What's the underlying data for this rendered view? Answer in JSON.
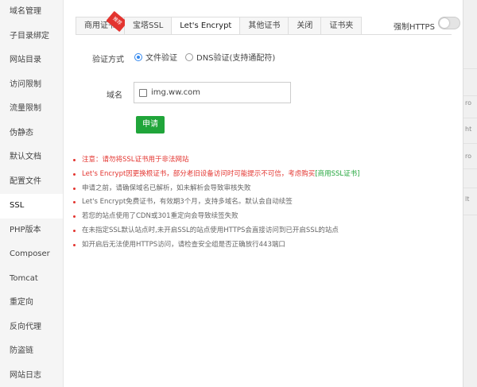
{
  "sidebar": {
    "items": [
      {
        "label": "域名管理"
      },
      {
        "label": "子目录绑定"
      },
      {
        "label": "网站目录"
      },
      {
        "label": "访问限制"
      },
      {
        "label": "流量限制"
      },
      {
        "label": "伪静态"
      },
      {
        "label": "默认文档"
      },
      {
        "label": "配置文件"
      },
      {
        "label": "SSL"
      },
      {
        "label": "PHP版本"
      },
      {
        "label": "Composer"
      },
      {
        "label": "Tomcat"
      },
      {
        "label": "重定向"
      },
      {
        "label": "反向代理"
      },
      {
        "label": "防盗链"
      },
      {
        "label": "网站日志"
      }
    ],
    "active_index": 8
  },
  "tabs": [
    {
      "label": "商用证书",
      "badge": "推荐"
    },
    {
      "label": "宝塔SSL"
    },
    {
      "label": "Let's Encrypt"
    },
    {
      "label": "其他证书"
    },
    {
      "label": "关闭"
    },
    {
      "label": "证书夹"
    }
  ],
  "active_tab_index": 2,
  "force_https": {
    "label": "强制HTTPS",
    "enabled": false
  },
  "verify": {
    "label": "验证方式",
    "options": [
      {
        "label": "文件验证",
        "checked": true
      },
      {
        "label": "DNS验证(支持通配符)",
        "checked": false
      }
    ]
  },
  "domain": {
    "label": "域名",
    "items": [
      {
        "name": "img.ww.com",
        "checked": false
      }
    ]
  },
  "apply_button": {
    "label": "申请"
  },
  "notes": [
    {
      "text": "注意：请勿将SSL证书用于非法网站",
      "red": true
    },
    {
      "text": "Let's Encrypt因更换根证书，部分老旧设备访问时可能提示不可信，考虑购买",
      "link": "[商用SSL证书]",
      "red": true
    },
    {
      "text": "申请之前，请确保域名已解析，如未解析会导致审核失败",
      "red": false
    },
    {
      "text": "Let's Encrypt免费证书，有效期3个月，支持多域名。默认会自动续签",
      "red": false
    },
    {
      "text": "若您的站点使用了CDN或301重定向会导致续签失败",
      "red": false
    },
    {
      "text": "在未指定SSL默认站点时,未开启SSL的站点使用HTTPS会直接访问到已开启SSL的站点",
      "red": false
    },
    {
      "text": "如开启后无法使用HTTPS访问，请检查安全组是否正确放行443端口",
      "red": false
    }
  ],
  "edge": {
    "texts": [
      "ro",
      "ht",
      "ro",
      "lt"
    ]
  },
  "colors": {
    "accent_green": "#20a53a",
    "warning_red": "#e3342f",
    "radio_blue": "#3388ee"
  }
}
